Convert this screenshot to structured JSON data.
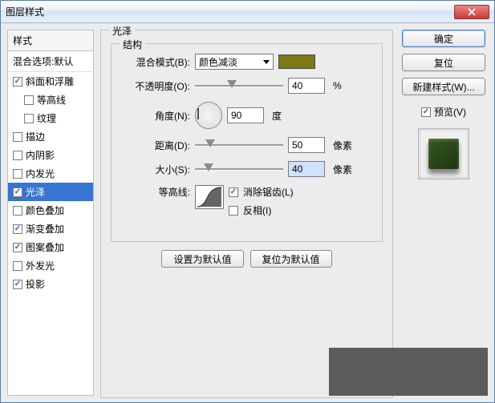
{
  "window": {
    "title": "图层样式"
  },
  "sidebar": {
    "header": "样式",
    "blend_options": "混合选项:默认",
    "items": [
      {
        "label": "斜面和浮雕",
        "checked": true,
        "indent": false
      },
      {
        "label": "等高线",
        "checked": false,
        "indent": true
      },
      {
        "label": "纹理",
        "checked": false,
        "indent": true
      },
      {
        "label": "描边",
        "checked": false,
        "indent": false
      },
      {
        "label": "内阴影",
        "checked": false,
        "indent": false
      },
      {
        "label": "内发光",
        "checked": false,
        "indent": false
      },
      {
        "label": "光泽",
        "checked": true,
        "indent": false,
        "selected": true
      },
      {
        "label": "颜色叠加",
        "checked": false,
        "indent": false
      },
      {
        "label": "渐变叠加",
        "checked": true,
        "indent": false
      },
      {
        "label": "图案叠加",
        "checked": true,
        "indent": false
      },
      {
        "label": "外发光",
        "checked": false,
        "indent": false
      },
      {
        "label": "投影",
        "checked": true,
        "indent": false
      }
    ]
  },
  "panel": {
    "title": "光泽",
    "group": "结构",
    "blend_mode_label": "混合模式(B):",
    "blend_mode_value": "颜色减淡",
    "swatch_color": "#7c7a14",
    "opacity_label": "不透明度(O):",
    "opacity_value": "40",
    "opacity_unit": "%",
    "angle_label": "角度(N):",
    "angle_value": "90",
    "angle_unit": "度",
    "distance_label": "距离(D):",
    "distance_value": "50",
    "distance_unit": "像素",
    "size_label": "大小(S):",
    "size_value": "40",
    "size_unit": "像素",
    "contour_label": "等高线:",
    "antialias_label": "消除锯齿(L)",
    "antialias_checked": true,
    "invert_label": "反相(I)",
    "invert_checked": false,
    "make_default_btn": "设置为默认值",
    "reset_default_btn": "复位为默认值"
  },
  "right": {
    "ok": "确定",
    "cancel": "复位",
    "new_style": "新建样式(W)...",
    "preview_label": "预览(V)",
    "preview_checked": true
  }
}
